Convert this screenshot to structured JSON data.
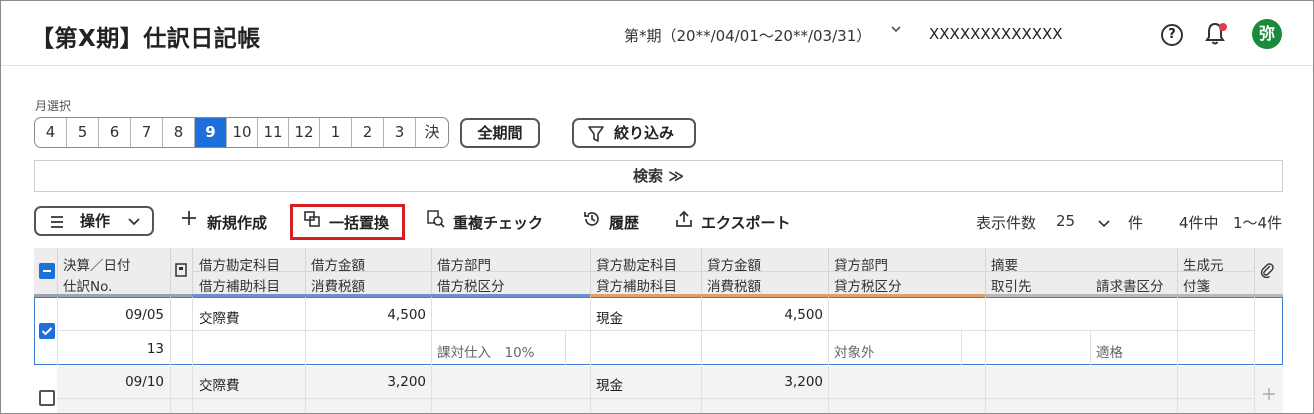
{
  "header": {
    "title": "【第X期】仕訳日記帳",
    "period": "第*期（20**/04/01〜20**/03/31）",
    "company": "XXXXXXXXXXXXX",
    "avatar": "弥",
    "help": "?"
  },
  "month_selector": {
    "label": "月選択",
    "months": [
      "4",
      "5",
      "6",
      "7",
      "8",
      "9",
      "10",
      "11",
      "12",
      "1",
      "2",
      "3",
      "決"
    ],
    "active": "9",
    "all_period": "全期間",
    "filter": "絞り込み"
  },
  "search": {
    "label": "検索 ≫"
  },
  "toolbar": {
    "operations": "操作",
    "new_entry": "新規作成",
    "bulk_replace": "一括置換",
    "duplicate_check": "重複チェック",
    "history": "履歴",
    "export": "エクスポート",
    "display_count_label": "表示件数",
    "display_count": "25",
    "count_unit": "件",
    "total": "4件中",
    "range": "1〜4件"
  },
  "table": {
    "headers": {
      "date": "決算／日付",
      "journal_no": "仕訳No.",
      "debit_account": "借方勘定科目",
      "debit_sub": "借方補助科目",
      "debit_amount": "借方金額",
      "debit_tax": "消費税額",
      "debit_dept": "借方部門",
      "debit_tax_class": "借方税区分",
      "credit_account": "貸方勘定科目",
      "credit_sub": "貸方補助科目",
      "credit_amount": "貸方金額",
      "credit_tax": "消費税額",
      "credit_dept": "貸方部門",
      "credit_tax_class": "貸方税区分",
      "summary": "摘要",
      "partner": "取引先",
      "invoice": "請求書区分",
      "origin": "生成元",
      "tag": "付箋"
    },
    "rows": [
      {
        "date": "09/05",
        "no": "13",
        "debit_account": "交際費",
        "debit_amount": "4,500",
        "debit_tax_class": "課対仕入　10%",
        "credit_account": "現金",
        "credit_amount": "4,500",
        "credit_tax_class": "対象外",
        "invoice": "適格"
      },
      {
        "date": "09/10",
        "debit_account": "交際費",
        "debit_amount": "3,200",
        "credit_account": "現金",
        "credit_amount": "3,200"
      }
    ]
  }
}
